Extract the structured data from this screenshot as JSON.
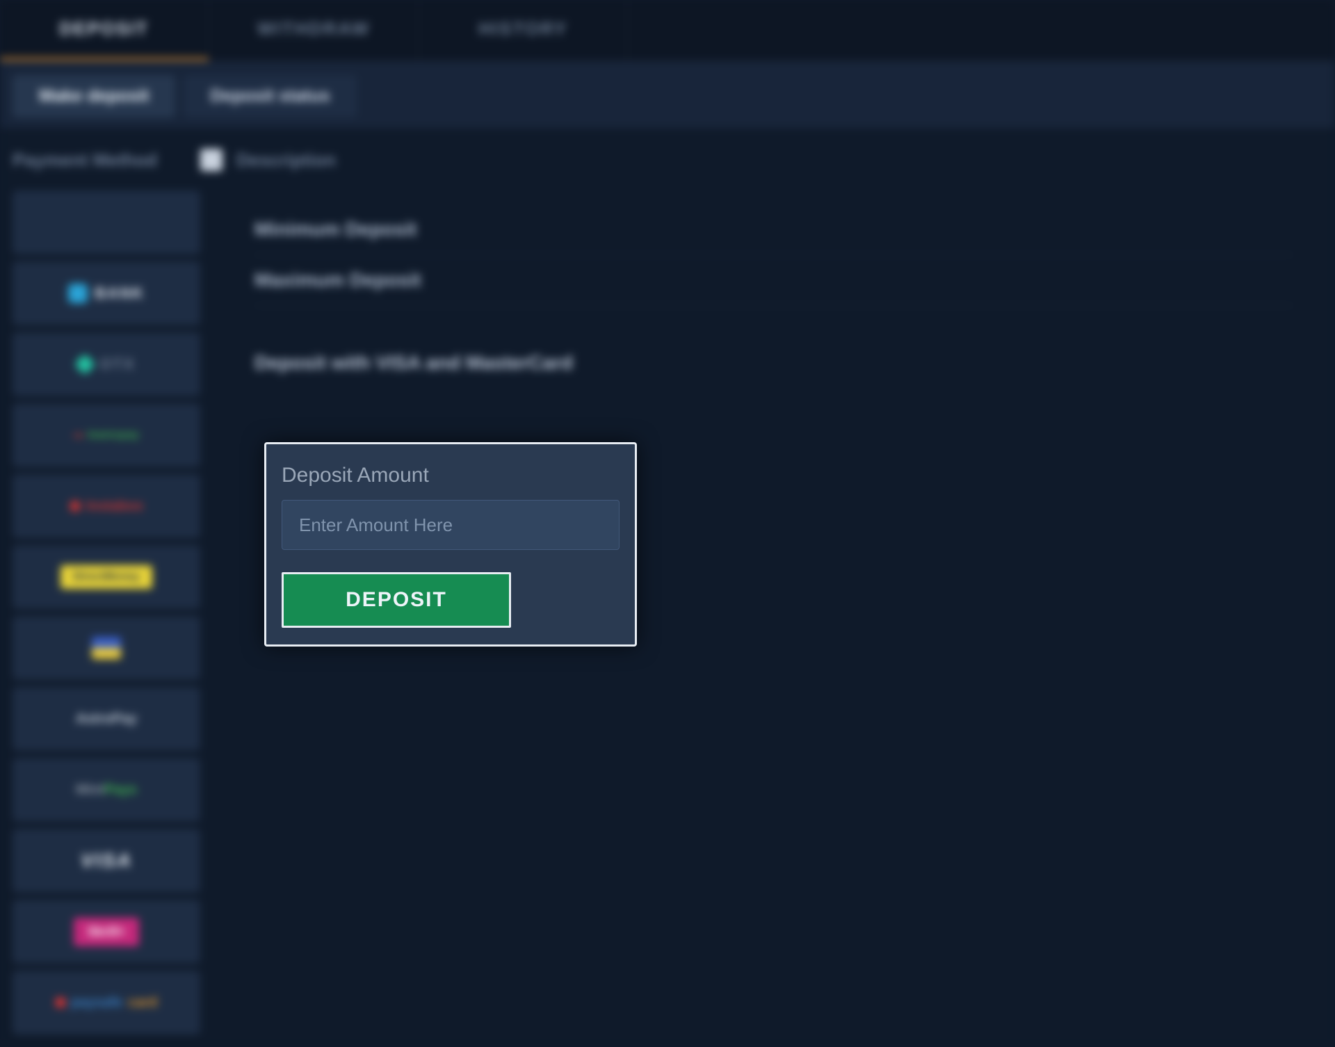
{
  "topTabs": {
    "deposit": "DEPOSIT",
    "withdraw": "WITHDRAW",
    "history": "HISTORY"
  },
  "subTabs": {
    "make": "Make deposit",
    "status": "Deposit status"
  },
  "columns": {
    "paymentMethod": "Payment Method",
    "description": "Description"
  },
  "paymentMethods": [
    {
      "id": "first",
      "label": ""
    },
    {
      "id": "bank",
      "label": "BANK"
    },
    {
      "id": "otx",
      "label": "OTX"
    },
    {
      "id": "greenstripe",
      "label": "teamspay"
    },
    {
      "id": "redone",
      "label": "Instabox"
    },
    {
      "id": "yellow",
      "label": "DirectMoney"
    },
    {
      "id": "flag",
      "label": ""
    },
    {
      "id": "astropay",
      "label": "AstroPay"
    },
    {
      "id": "mintpays",
      "label": "MintPays"
    },
    {
      "id": "visa",
      "label": "VISA"
    },
    {
      "id": "skrill",
      "label": "Skrill+"
    },
    {
      "id": "paysafe",
      "label": "paysafe"
    }
  ],
  "description": {
    "minDeposit": "Minimum Deposit",
    "maxDeposit": "Maximum Deposit",
    "note": "Deposit with VISA and MasterCard"
  },
  "depositPanel": {
    "label": "Deposit Amount",
    "placeholder": "Enter Amount Here",
    "button": "DEPOSIT"
  }
}
